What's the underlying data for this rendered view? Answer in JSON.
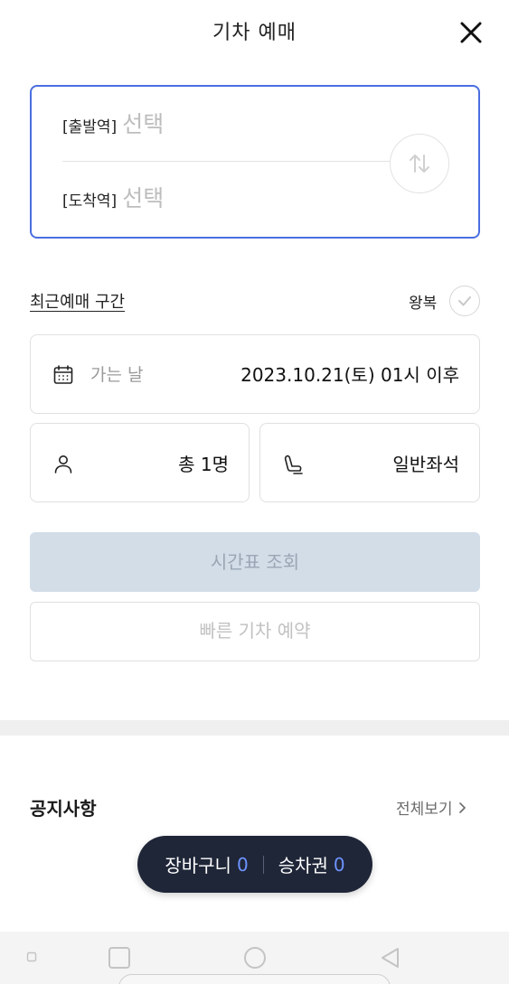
{
  "header": {
    "title": "기차 예매",
    "close_icon": "close-icon"
  },
  "stations": {
    "departure_label": "[출발역]",
    "departure_value": "선택",
    "arrival_label": "[도착역]",
    "arrival_value": "선택",
    "swap_icon": "swap-vertical-icon"
  },
  "options": {
    "recent_link": "최근예매 구간",
    "roundtrip_label": "왕복",
    "roundtrip_checked": false
  },
  "date": {
    "icon": "calendar-icon",
    "placeholder": "가는 날",
    "value": "2023.10.21(토) 01시 이후"
  },
  "passengers": {
    "icon": "person-icon",
    "value": "총 1명"
  },
  "seat": {
    "icon": "seat-icon",
    "value": "일반좌석"
  },
  "buttons": {
    "search": "시간표 조회",
    "quick_reserve": "빠른 기차 예약"
  },
  "notice": {
    "title": "공지사항",
    "more": "전체보기"
  },
  "cart": {
    "cart_label": "장바구니",
    "cart_count": "0",
    "ticket_label": "승차권",
    "ticket_count": "0"
  },
  "colors": {
    "accent_border": "#4a6ee0",
    "disabled_button": "#d2dde8",
    "cart_bg": "#1f2638",
    "cart_count": "#6d93ff"
  }
}
